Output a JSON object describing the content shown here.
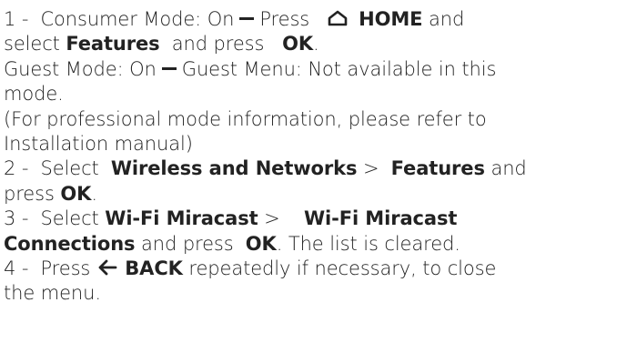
{
  "icons": {
    "home": "home-icon",
    "back": "back-arrow-icon",
    "dash": "dash-icon"
  },
  "step1": {
    "num": "1 -",
    "consumer": "Consumer Mode: On",
    "press": "Press",
    "home": "HOME",
    "and": "and",
    "select": "select",
    "features": "Features",
    "and_press": "and press",
    "ok": "OK",
    "period": "."
  },
  "guest": {
    "mode": "Guest Mode: On",
    "menu": "Guest Menu: Not available in this",
    "mode_end": "mode."
  },
  "note": {
    "line1": "(For professional mode information, please refer to",
    "line2": "Installation manual)"
  },
  "step2": {
    "num": "2 -",
    "select": "Select",
    "wireless": "Wireless and Networks",
    "gt": ">",
    "features": "Features",
    "and": "and",
    "press": "press",
    "ok": "OK",
    "period": "."
  },
  "step3": {
    "num": "3 -",
    "select": "Select",
    "miracast": "Wi-Fi Miracast",
    "gt": ">",
    "miracast2": "Wi-Fi Miracast",
    "connections": "Connections",
    "and_press": "and press",
    "ok": "OK",
    "tail": ". The list is cleared."
  },
  "step4": {
    "num": "4 -",
    "press": "Press",
    "back": "BACK",
    "tail": "repeatedly if necessary, to close",
    "end": "the menu."
  }
}
